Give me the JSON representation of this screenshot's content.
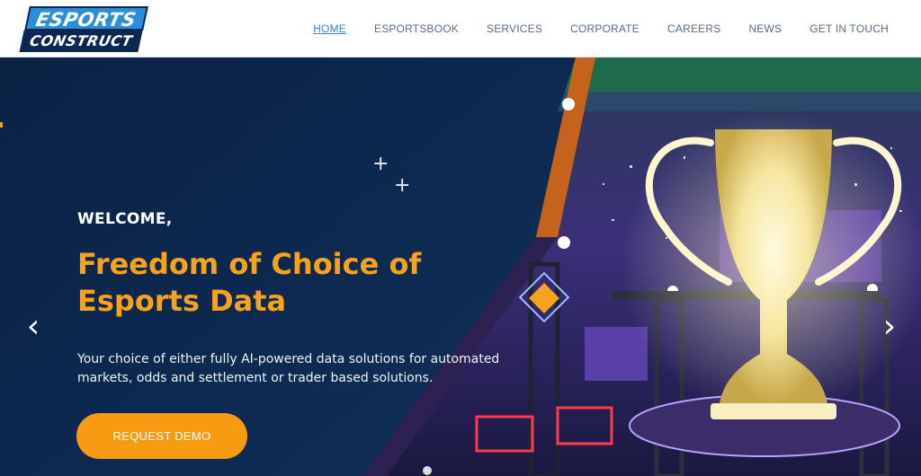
{
  "brand": {
    "line1": "ESPORTS",
    "line2": "CONSTRUCT",
    "colors": {
      "primary": "#2a8fd8",
      "dark": "#0c2850"
    }
  },
  "nav": {
    "items": [
      {
        "label": "HOME",
        "active": true
      },
      {
        "label": "ESPORTSBOOK"
      },
      {
        "label": "SERVICES"
      },
      {
        "label": "CORPORATE"
      },
      {
        "label": "CAREERS"
      },
      {
        "label": "NEWS"
      },
      {
        "label": "GET IN TOUCH"
      }
    ]
  },
  "hero": {
    "welcome": "WELCOME,",
    "headline": "Freedom of Choice of Esports Data",
    "subtext": "Your choice of either fully AI-powered data solutions for automated markets, odds and settlement or trader based solutions.",
    "cta_label": "REQUEST DEMO",
    "prev_icon": "chevron-left-icon",
    "next_icon": "chevron-right-icon",
    "accent_color": "#f79c12",
    "background_color": "#0d2a52"
  }
}
